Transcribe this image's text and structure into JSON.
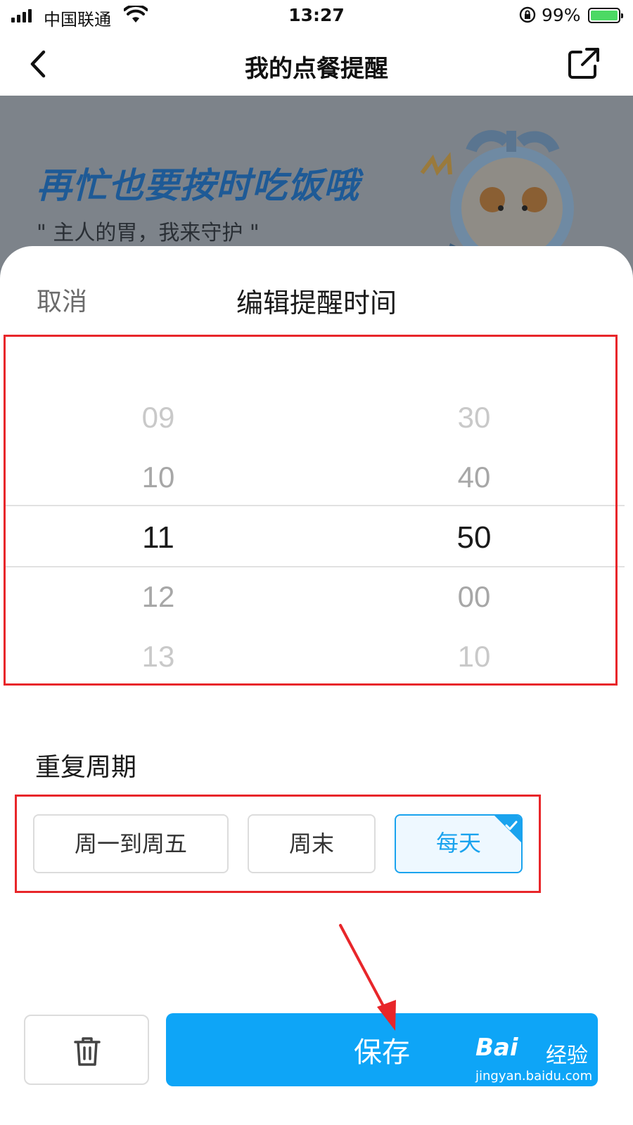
{
  "status_bar": {
    "carrier": "中国联通",
    "time": "13:27",
    "battery_percent": "99%",
    "icons": [
      "signal-icon",
      "wifi-icon",
      "orientation-lock-icon",
      "battery-charging-icon"
    ]
  },
  "nav": {
    "title": "我的点餐提醒",
    "back_icon": "back-chevron-icon",
    "share_icon": "share-icon"
  },
  "banner": {
    "headline": "再忙也要按时吃饭哦",
    "subtitle": "\" 主人的胃，我来守护 \"",
    "mascot_icon": "alarm-clock-mascot-icon"
  },
  "sheet": {
    "cancel_label": "取消",
    "title": "编辑提醒时间"
  },
  "picker": {
    "hours": [
      "09",
      "10",
      "11",
      "12",
      "13"
    ],
    "minutes": [
      "30",
      "40",
      "50",
      "00",
      "10"
    ],
    "selected_hour": "11",
    "selected_minute": "50"
  },
  "repeat": {
    "label": "重复周期",
    "options": [
      "周一到周五",
      "周末",
      "每天"
    ],
    "selected": "每天"
  },
  "actions": {
    "delete_icon": "trash-icon",
    "save_label": "保存"
  },
  "watermark": {
    "brand": "Bai",
    "brand2": "经验",
    "url": "jingyan.baidu.com"
  },
  "colors": {
    "accent": "#0ea5f7",
    "selected_option": "#1aa3ee",
    "annotation_red": "#e8262a",
    "banner_bg": "#7d838a",
    "headline": "#1e5a96"
  }
}
